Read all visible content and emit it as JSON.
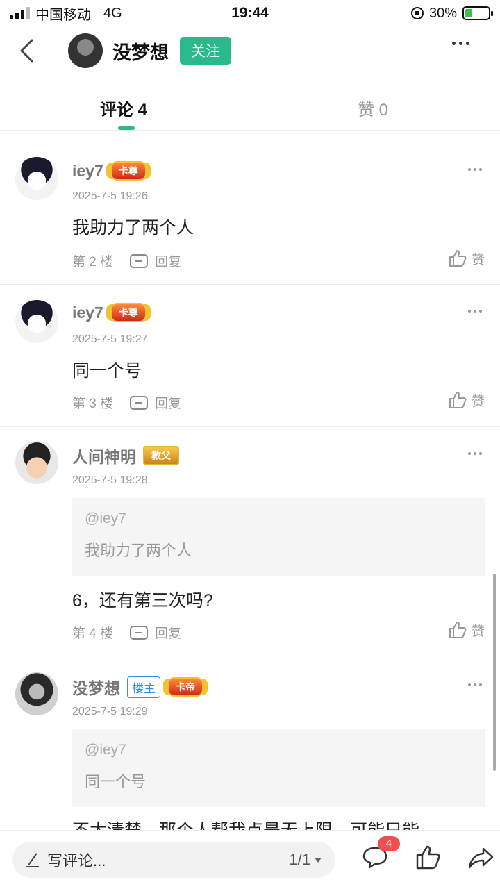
{
  "status_bar": {
    "carrier": "中国移动",
    "network": "4G",
    "time": "19:44",
    "battery": "30%",
    "battery_level": 0.3
  },
  "header": {
    "title": "没梦想",
    "follow_label": "关注"
  },
  "tabs": [
    {
      "label": "评论 4"
    },
    {
      "label": "赞 0"
    }
  ],
  "comments": [
    {
      "user": "iey7",
      "badge": "卡尊",
      "time": "2025-7-5 19:26",
      "text": "我助力了两个人",
      "floor": "第 2 楼",
      "reply": "回复",
      "like": "赞"
    },
    {
      "user": "iey7",
      "badge": "卡尊",
      "time": "2025-7-5 19:27",
      "text": "同一个号",
      "floor": "第 3 楼",
      "reply": "回复",
      "like": "赞"
    },
    {
      "user": "人间神明",
      "badge": "教父",
      "time": "2025-7-5 19:28",
      "quote_at": "@iey7",
      "quote_text": "我助力了两个人",
      "text": "6，还有第三次吗?",
      "floor": "第 4 楼",
      "reply": "回复",
      "like": "赞"
    },
    {
      "user": "没梦想",
      "owner": "楼主",
      "badge": "卡帝",
      "time": "2025-7-5 19:29",
      "quote_at": "@iey7",
      "quote_text": "同一个号",
      "text": "不太清楚，那个人帮我点是无上限，可能只能"
    }
  ],
  "bottom": {
    "placeholder": "写评论...",
    "page": "1/1",
    "comment_count": "4"
  },
  "colors": {
    "accent": "#2bb88a",
    "badge_red": "#f04f4f"
  }
}
